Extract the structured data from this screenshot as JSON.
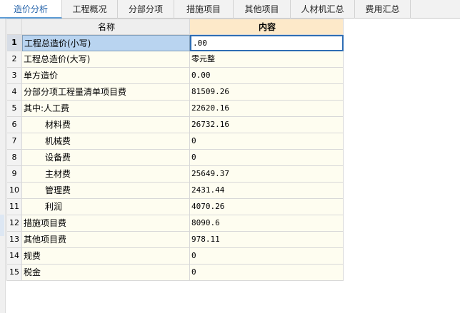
{
  "tabs": [
    {
      "label": "造价分析",
      "active": true
    },
    {
      "label": "工程概况",
      "active": false
    },
    {
      "label": "分部分项",
      "active": false
    },
    {
      "label": "措施项目",
      "active": false
    },
    {
      "label": "其他项目",
      "active": false
    },
    {
      "label": "人材机汇总",
      "active": false
    },
    {
      "label": "费用汇总",
      "active": false
    }
  ],
  "table": {
    "headers": {
      "name": "名称",
      "value": "内容"
    },
    "rows": [
      {
        "num": "1",
        "name": "工程总造价(小写)",
        "value": ".00",
        "indent": false,
        "selected": true
      },
      {
        "num": "2",
        "name": "工程总造价(大写)",
        "value": "零元整",
        "indent": false
      },
      {
        "num": "3",
        "name": "单方造价",
        "value": "0.00",
        "indent": false
      },
      {
        "num": "4",
        "name": "分部分项工程量清单项目费",
        "value": "81509.26",
        "indent": false
      },
      {
        "num": "5",
        "name": "其中:人工费",
        "value": "22620.16",
        "indent": false
      },
      {
        "num": "6",
        "name": "材料费",
        "value": "26732.16",
        "indent": true
      },
      {
        "num": "7",
        "name": "机械费",
        "value": "0",
        "indent": true
      },
      {
        "num": "8",
        "name": "设备费",
        "value": "0",
        "indent": true
      },
      {
        "num": "9",
        "name": "主材费",
        "value": "25649.37",
        "indent": true
      },
      {
        "num": "10",
        "name": "管理费",
        "value": "2431.44",
        "indent": true
      },
      {
        "num": "11",
        "name": "利润",
        "value": "4070.26",
        "indent": true
      },
      {
        "num": "12",
        "name": "措施项目费",
        "value": "8090.6",
        "indent": false
      },
      {
        "num": "13",
        "name": "其他项目费",
        "value": "978.11",
        "indent": false
      },
      {
        "num": "14",
        "name": "规费",
        "value": "0",
        "indent": false
      },
      {
        "num": "15",
        "name": "税金",
        "value": "0",
        "indent": false
      }
    ]
  }
}
